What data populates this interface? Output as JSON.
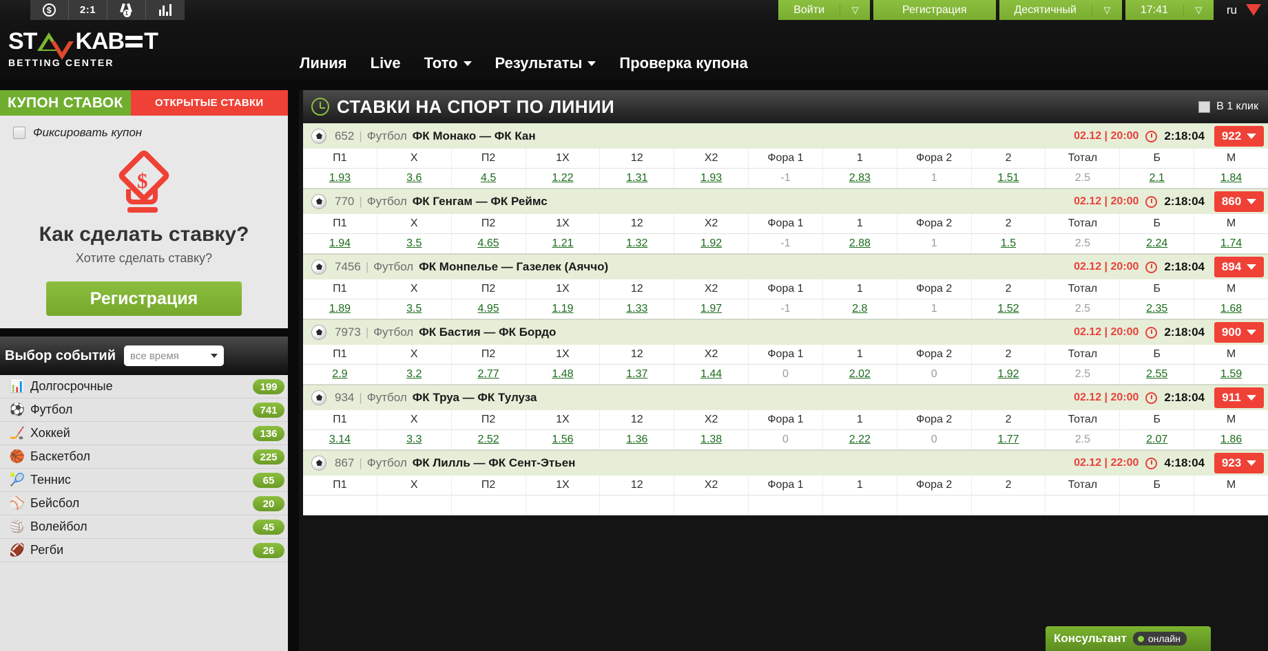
{
  "topbar": {
    "icons": [
      {
        "name": "coin-icon",
        "glyph": "$"
      },
      {
        "name": "score-icon",
        "glyph": "2:1"
      },
      {
        "name": "medal-icon",
        "glyph": "1"
      },
      {
        "name": "stats-icon",
        "glyph": "bars"
      }
    ],
    "login_label": "Войти",
    "register_label": "Регистрация",
    "odds_format_label": "Десятичный",
    "time_label": "17:41",
    "lang_label": "ru"
  },
  "logo": {
    "part1": "ST",
    "part2": "KAB",
    "tagline": "BETTING CENTER"
  },
  "nav": [
    {
      "label": "Линия",
      "caret": false
    },
    {
      "label": "Live",
      "caret": false
    },
    {
      "label": "Тото",
      "caret": true
    },
    {
      "label": "Результаты",
      "caret": true
    },
    {
      "label": "Проверка купона",
      "caret": false
    }
  ],
  "coupon": {
    "tab_coupon": "КУПОН СТАВОК",
    "tab_open": "ОТКРЫТЫЕ СТАВКИ",
    "fix_label": "Фиксировать купон",
    "heading": "Как сделать ставку?",
    "subheading": "Хотите сделать ставку?",
    "register_button": "Регистрация",
    "dollar_glyph": "$"
  },
  "events_filter": {
    "label": "Выбор событий",
    "selected": "все время"
  },
  "sports": [
    {
      "name": "Долгосрочные",
      "count": "199",
      "icon": "chart-icon",
      "glyph": "📊"
    },
    {
      "name": "Футбол",
      "count": "741",
      "icon": "football-icon",
      "glyph": "⚽"
    },
    {
      "name": "Хоккей",
      "count": "136",
      "icon": "hockey-icon",
      "glyph": "🏒"
    },
    {
      "name": "Баскетбол",
      "count": "225",
      "icon": "basketball-icon",
      "glyph": "🏀"
    },
    {
      "name": "Теннис",
      "count": "65",
      "icon": "tennis-icon",
      "glyph": "🎾"
    },
    {
      "name": "Бейсбол",
      "count": "20",
      "icon": "baseball-icon",
      "glyph": "⚾"
    },
    {
      "name": "Волейбол",
      "count": "45",
      "icon": "volleyball-icon",
      "glyph": "🏐"
    },
    {
      "name": "Регби",
      "count": "26",
      "icon": "rugby-icon",
      "glyph": "🏈"
    }
  ],
  "main": {
    "title": "СТАВКИ НА СПОРТ ПО ЛИНИИ",
    "oneclick_label": "В 1 клик"
  },
  "columns": [
    "П1",
    "X",
    "П2",
    "1X",
    "12",
    "X2",
    "Фора 1",
    "1",
    "Фора 2",
    "2",
    "Тотал",
    "Б",
    "М"
  ],
  "events": [
    {
      "id": "652",
      "sport": "Футбол",
      "teams": "ФК Монако — ФК Кан",
      "date": "02.12 | 20:00",
      "countdown": "2:18:04",
      "badge": "922",
      "odds": [
        "1.93",
        "3.6",
        "4.5",
        "1.22",
        "1.31",
        "1.93",
        "-1",
        "2.83",
        "1",
        "1.51",
        "2.5",
        "2.1",
        "1.84"
      ],
      "plain": [
        false,
        false,
        false,
        false,
        false,
        false,
        true,
        false,
        true,
        false,
        true,
        false,
        false
      ]
    },
    {
      "id": "770",
      "sport": "Футбол",
      "teams": "ФК Генгам — ФК Реймс",
      "date": "02.12 | 20:00",
      "countdown": "2:18:04",
      "badge": "860",
      "odds": [
        "1.94",
        "3.5",
        "4.65",
        "1.21",
        "1.32",
        "1.92",
        "-1",
        "2.88",
        "1",
        "1.5",
        "2.5",
        "2.24",
        "1.74"
      ],
      "plain": [
        false,
        false,
        false,
        false,
        false,
        false,
        true,
        false,
        true,
        false,
        true,
        false,
        false
      ]
    },
    {
      "id": "7456",
      "sport": "Футбол",
      "teams": "ФК Монпелье — Газелек (Аяччо)",
      "date": "02.12 | 20:00",
      "countdown": "2:18:04",
      "badge": "894",
      "odds": [
        "1.89",
        "3.5",
        "4.95",
        "1.19",
        "1.33",
        "1.97",
        "-1",
        "2.8",
        "1",
        "1.52",
        "2.5",
        "2.35",
        "1.68"
      ],
      "plain": [
        false,
        false,
        false,
        false,
        false,
        false,
        true,
        false,
        true,
        false,
        true,
        false,
        false
      ]
    },
    {
      "id": "7973",
      "sport": "Футбол",
      "teams": "ФК Бастия — ФК Бордо",
      "date": "02.12 | 20:00",
      "countdown": "2:18:04",
      "badge": "900",
      "odds": [
        "2.9",
        "3.2",
        "2.77",
        "1.48",
        "1.37",
        "1.44",
        "0",
        "2.02",
        "0",
        "1.92",
        "2.5",
        "2.55",
        "1.59"
      ],
      "plain": [
        false,
        false,
        false,
        false,
        false,
        false,
        true,
        false,
        true,
        false,
        true,
        false,
        false
      ]
    },
    {
      "id": "934",
      "sport": "Футбол",
      "teams": "ФК Труа — ФК Тулуза",
      "date": "02.12 | 20:00",
      "countdown": "2:18:04",
      "badge": "911",
      "odds": [
        "3.14",
        "3.3",
        "2.52",
        "1.56",
        "1.36",
        "1.38",
        "0",
        "2.22",
        "0",
        "1.77",
        "2.5",
        "2.07",
        "1.86"
      ],
      "plain": [
        false,
        false,
        false,
        false,
        false,
        false,
        true,
        false,
        true,
        false,
        true,
        false,
        false
      ]
    },
    {
      "id": "867",
      "sport": "Футбол",
      "teams": "ФК Лилль — ФК Сент-Этьен",
      "date": "02.12 | 22:00",
      "countdown": "4:18:04",
      "badge": "923",
      "odds": [
        "",
        "",
        "",
        "",
        "",
        "",
        "",
        "",
        "",
        "",
        "",
        "",
        ""
      ],
      "plain": [
        false,
        false,
        false,
        false,
        false,
        false,
        true,
        false,
        true,
        false,
        true,
        false,
        false
      ]
    }
  ],
  "consultant": {
    "label": "Консультант",
    "status": "онлайн"
  },
  "colors": {
    "green": "#7ab42d",
    "red": "#ef4136",
    "odds_green": "#17651c"
  }
}
